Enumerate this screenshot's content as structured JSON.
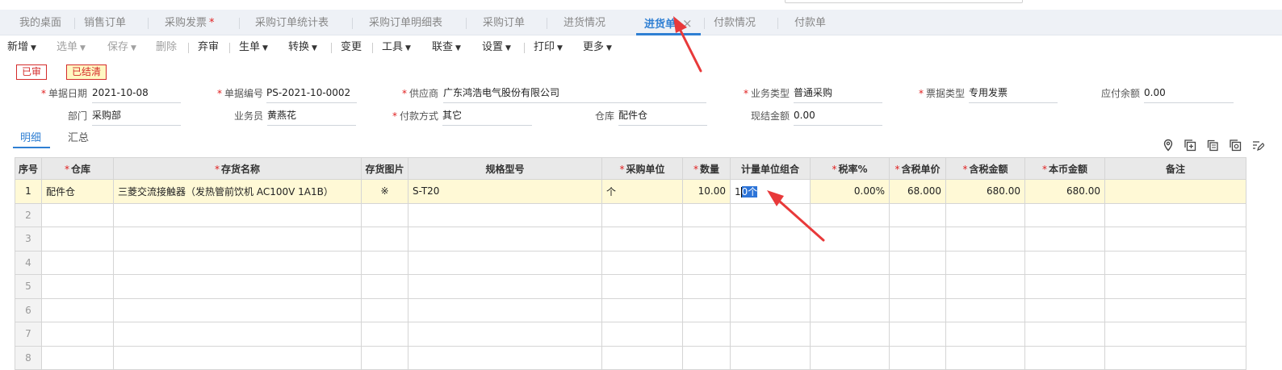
{
  "tabs": [
    {
      "label": "我的桌面",
      "required": false
    },
    {
      "label": "销售订单",
      "required": false
    },
    {
      "label": "采购发票",
      "required": true
    },
    {
      "label": "采购订单统计表",
      "required": false
    },
    {
      "label": "采购订单明细表",
      "required": false
    },
    {
      "label": "采购订单",
      "required": false
    },
    {
      "label": "进货情况",
      "required": false
    },
    {
      "label": "进货单",
      "required": false,
      "active": true
    },
    {
      "label": "付款情况",
      "required": false
    },
    {
      "label": "付款单",
      "required": false
    }
  ],
  "tab_close": "×",
  "required_mark": "*",
  "toolbar": {
    "new": "新增",
    "select": "选单",
    "save": "保存",
    "delete": "删除",
    "discard": "弃审",
    "generate": "生单",
    "convert": "转换",
    "change": "变更",
    "tools": "工具",
    "linked": "联查",
    "settings": "设置",
    "print": "打印",
    "more": "更多",
    "caret": "▼"
  },
  "badges": {
    "audited": "已审",
    "settled": "已结清"
  },
  "header": {
    "date_label": "单据日期",
    "date": "2021-10-08",
    "docno_label": "单据编号",
    "docno": "PS-2021-10-0002",
    "supplier_label": "供应商",
    "supplier": "广东鸿浩电气股份有限公司",
    "biztype_label": "业务类型",
    "biztype": "普通采购",
    "invtype_label": "票据类型",
    "invtype": "专用发票",
    "payable_label": "应付余额",
    "payable": "0.00",
    "dept_label": "部门",
    "dept": "采购部",
    "clerk_label": "业务员",
    "clerk": "黄燕花",
    "paymethod_label": "付款方式",
    "paymethod": "其它",
    "warehouse_label": "仓库",
    "warehouse": "配件仓",
    "cash_label": "现结金额",
    "cash": "0.00"
  },
  "subtabs": {
    "detail": "明细",
    "summary": "汇总"
  },
  "grid": {
    "columns": [
      {
        "label": "序号",
        "required": false
      },
      {
        "label": "仓库",
        "required": true
      },
      {
        "label": "存货名称",
        "required": true
      },
      {
        "label": "存货图片",
        "required": false
      },
      {
        "label": "规格型号",
        "required": false
      },
      {
        "label": "采购单位",
        "required": true
      },
      {
        "label": "数量",
        "required": true
      },
      {
        "label": "计量单位组合",
        "required": false
      },
      {
        "label": "税率%",
        "required": true
      },
      {
        "label": "含税单价",
        "required": true
      },
      {
        "label": "含税金额",
        "required": true
      },
      {
        "label": "本币金额",
        "required": true
      },
      {
        "label": "备注",
        "required": false
      }
    ],
    "row1": {
      "no": "1",
      "warehouse": "配件仓",
      "name": "三菱交流接触器（发热管前饮机 AC100V 1A1B）",
      "image": "※",
      "spec": "S-T20",
      "unit": "个",
      "qty": "10.00",
      "combo_prefix": "1",
      "combo_selected": "0个",
      "tax": "0.00%",
      "price": "68.000",
      "amount": "680.00",
      "local": "680.00",
      "remark": ""
    },
    "empty_rows": [
      "2",
      "3",
      "4",
      "5",
      "6",
      "7",
      "8"
    ]
  },
  "colors": {
    "accent": "#2f7fd3",
    "required": "#e02020",
    "arrow": "#e8393a",
    "highlight_row": "#fff9d6"
  }
}
